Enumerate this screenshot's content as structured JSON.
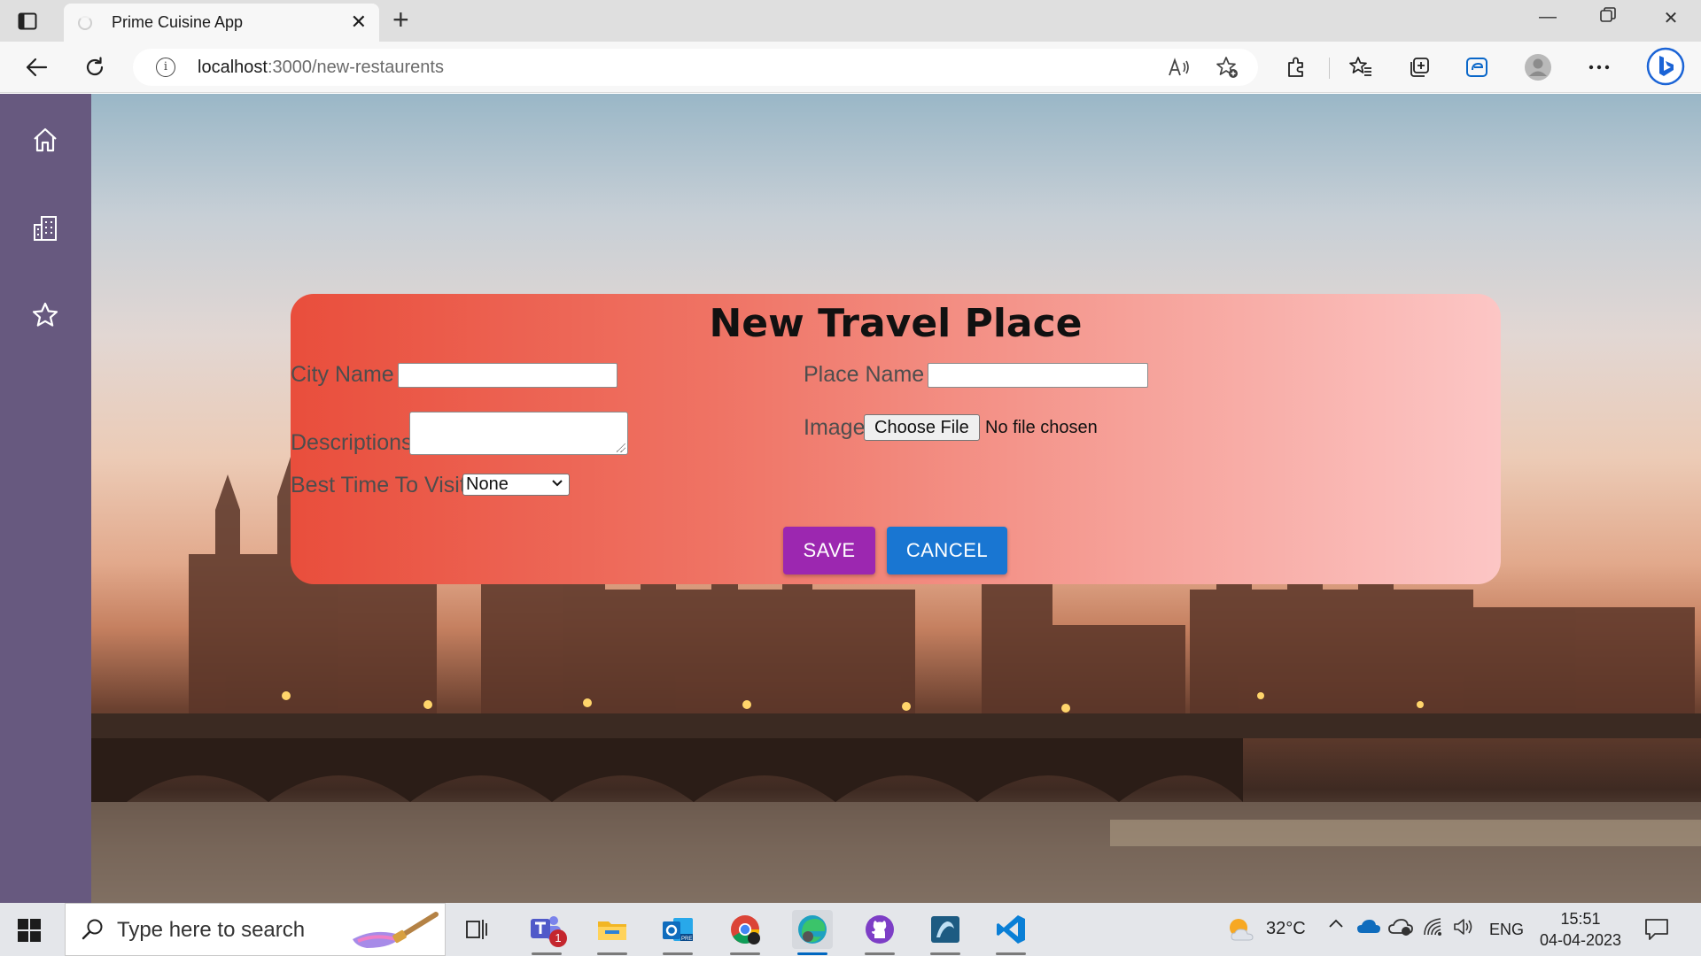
{
  "browser": {
    "tab_title": "Prime Cuisine App",
    "url_host": "localhost",
    "url_path": ":3000/new-restaurents"
  },
  "sidebar": {
    "items": [
      {
        "icon": "home-icon"
      },
      {
        "icon": "building-icon"
      },
      {
        "icon": "star-icon"
      }
    ]
  },
  "form": {
    "title": "New Travel Place",
    "city_label": "City Name",
    "city_value": "",
    "place_label": "Place Name",
    "place_value": "",
    "descriptions_label": "Descriptions",
    "descriptions_value": "",
    "image_label": "Image",
    "file_button": "Choose File",
    "file_status": "No file chosen",
    "best_time_label": "Best Time To Visit",
    "best_time_value": "None",
    "save_label": "SAVE",
    "cancel_label": "CANCEL",
    "colors": {
      "save": "#9c27b0",
      "cancel": "#1976d2"
    }
  },
  "taskbar": {
    "search_placeholder": "Type here to search",
    "weather": "32°C",
    "language": "ENG",
    "time": "15:51",
    "date": "04-04-2023",
    "teams_badge": "1"
  }
}
